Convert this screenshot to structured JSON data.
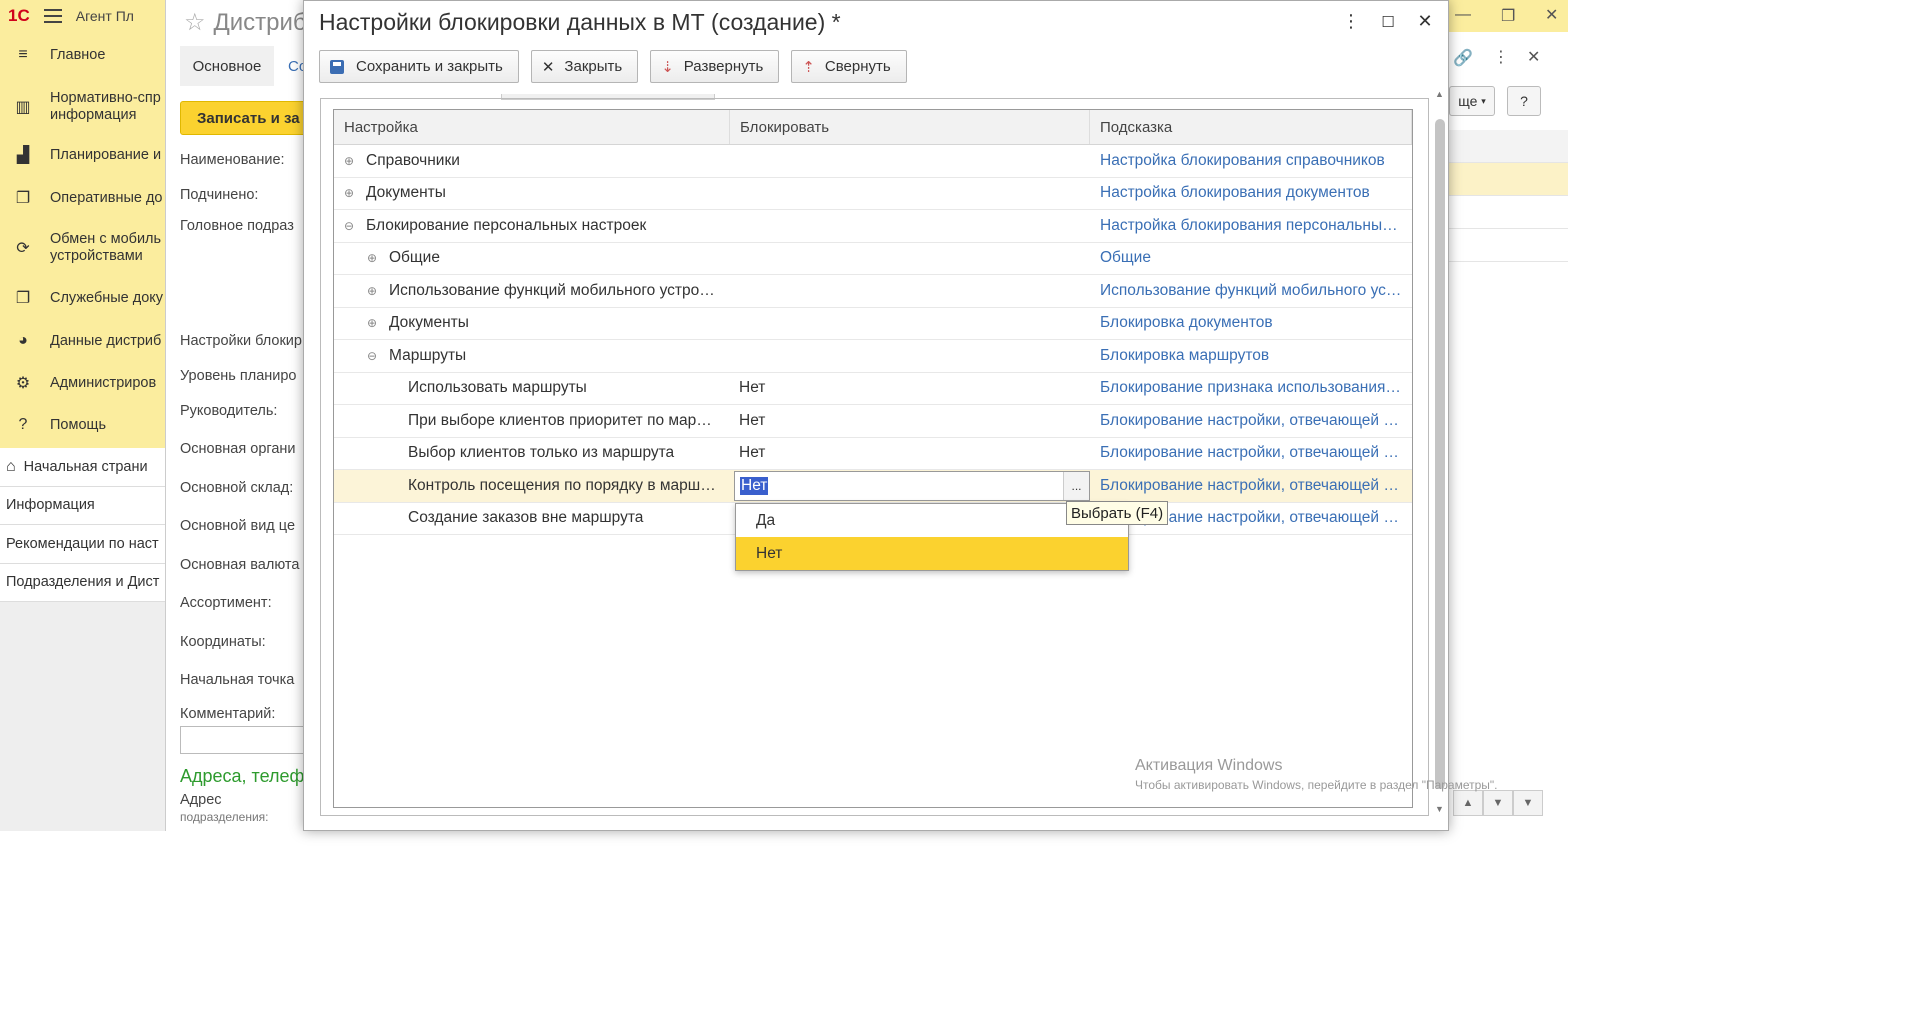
{
  "app": {
    "logo": "1С",
    "title": "Агент Пл"
  },
  "sidebar": {
    "items": [
      {
        "icon": "menu-lines-icon",
        "label": "Главное"
      },
      {
        "icon": "bars-icon",
        "label": "Нормативно-спр информация"
      },
      {
        "icon": "chart-icon",
        "label": "Планирование и"
      },
      {
        "icon": "docs-icon",
        "label": "Оперативные до"
      },
      {
        "icon": "sync-icon",
        "label": "Обмен с мобиль устройствами"
      },
      {
        "icon": "docs-icon",
        "label": "Служебные доку"
      },
      {
        "icon": "pie-icon",
        "label": "Данные дистриб"
      },
      {
        "icon": "gear-icon",
        "label": "Администриров"
      },
      {
        "icon": "help-icon",
        "label": "Помощь"
      }
    ]
  },
  "pages": [
    {
      "label": "Начальная страни",
      "home": true
    },
    {
      "label": "Информация"
    },
    {
      "label": "Рекомендации по наст"
    },
    {
      "label": "Подразделения и Дист"
    }
  ],
  "bg_form": {
    "title": "Дистриб",
    "tab_main": "Основное",
    "tab_second": "Со",
    "save_button": "Записать и за",
    "labels": [
      "Наименование:",
      "Подчинено:",
      "Головное подраз",
      "Настройки блокир",
      "Уровень планиро",
      "Руководитель:",
      "Основная органи",
      "Основной склад:",
      "Основной вид це",
      "Основная валюта",
      "Ассортимент:",
      "Координаты:",
      "Начальная точка",
      "Комментарий:",
      "Адрес"
    ],
    "extra_label": "подразделения:",
    "section_green": "Адреса, телеф"
  },
  "right_bg": {
    "more_label": "ще",
    "help_label": "?"
  },
  "modal": {
    "title": "Настройки блокировки данных в МТ (создание) *",
    "toolbar": {
      "save_close": "Сохранить и закрыть",
      "close": "Закрыть",
      "expand": "Развернуть",
      "collapse": "Свернуть"
    },
    "grid": {
      "headers": [
        "Настройка",
        "Блокировать",
        "Подсказка"
      ],
      "rows": [
        {
          "name": "Справочники",
          "level": 0,
          "toggle": "⊕",
          "value": "",
          "hint": "Настройка блокирования справочников"
        },
        {
          "name": "Документы",
          "level": 0,
          "toggle": "⊕",
          "value": "",
          "hint": "Настройка блокирования документов"
        },
        {
          "name": "Блокирование персональных настроек",
          "level": 0,
          "toggle": "⊖",
          "value": "",
          "hint": "Настройка блокирования персональных настроек"
        },
        {
          "name": "Общие",
          "level": 1,
          "toggle": "⊕",
          "value": "",
          "hint": "Общие"
        },
        {
          "name": "Использование функций мобильного устро…",
          "level": 1,
          "toggle": "⊕",
          "value": "",
          "hint": "Использование функций мобильного ус…"
        },
        {
          "name": "Документы",
          "level": 1,
          "toggle": "⊕",
          "value": "",
          "hint": "Блокировка документов"
        },
        {
          "name": "Маршруты",
          "level": 1,
          "toggle": "⊖",
          "value": "",
          "hint": "Блокировка маршрутов"
        },
        {
          "name": "Использовать маршруты",
          "level": 2,
          "toggle": "",
          "value": "Нет",
          "hint": "Блокирование признака использования …"
        },
        {
          "name": "При выборе клиентов приоритет по мар…",
          "level": 2,
          "toggle": "",
          "value": "Нет",
          "hint": "Блокирование настройки, отвечающей з…"
        },
        {
          "name": "Выбор клиентов только из маршрута",
          "level": 2,
          "toggle": "",
          "value": "Нет",
          "hint": "Блокирование настройки, отвечающей з…"
        },
        {
          "name": "Контроль посещения по порядку в марш…",
          "level": 2,
          "toggle": "",
          "value": "Нет",
          "hint": "Блокирование настройки, отвечающей з…",
          "editing": true
        },
        {
          "name": "Создание заказов вне маршрута",
          "level": 2,
          "toggle": "",
          "value": "",
          "hint": "Блокирование настройки, отвечающей …"
        }
      ]
    },
    "edit_dots": "...",
    "dropdown_options": [
      "Да",
      "Нет"
    ],
    "tooltip": "Выбрать (F4)"
  },
  "watermark": {
    "line1": "Активация Windows",
    "line2": "Чтобы активировать Windows, перейдите в раздел \"Параметры\"."
  },
  "colors": {
    "accent_yellow": "#fbd22f",
    "sidebar_bg": "#fbed9e",
    "link_blue": "#3a6fb5",
    "selected_row": "#fcf4d8"
  }
}
